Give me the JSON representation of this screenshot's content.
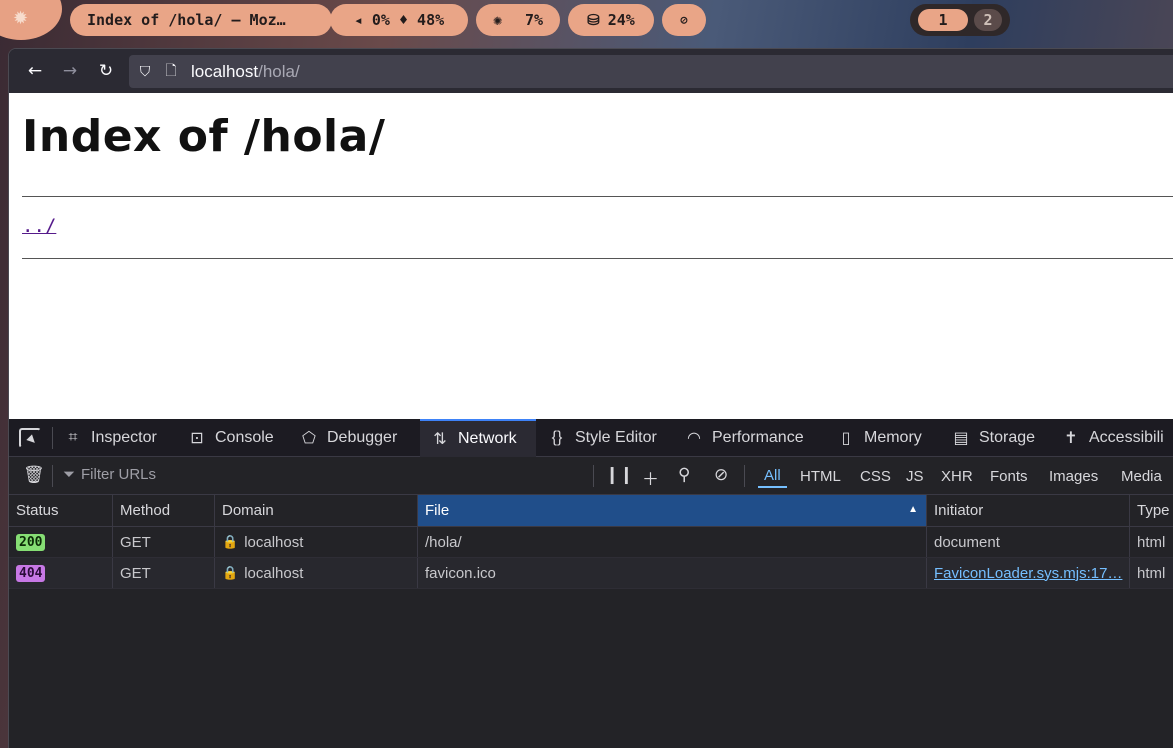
{
  "topbar": {
    "window_title": "Index of /hola/ — Moz…",
    "audio": "◂ 0% ♦ 48%",
    "cpu_value": "7%",
    "mem_value": "24%",
    "workspaces": [
      "1",
      "2"
    ],
    "colors": {
      "pill": "#e9a587",
      "pill_text": "#231c1c"
    }
  },
  "browser": {
    "url_host": "localhost",
    "url_path": "/hola/"
  },
  "page": {
    "heading": "Index of /hola/",
    "parent_link": "../"
  },
  "devtools": {
    "tabs": [
      "Inspector",
      "Console",
      "Debugger",
      "Network",
      "Style Editor",
      "Performance",
      "Memory",
      "Storage",
      "Accessibili"
    ],
    "selected_tab": "Network",
    "filter_placeholder": "Filter URLs",
    "filter_types": [
      "All",
      "HTML",
      "CSS",
      "JS",
      "XHR",
      "Fonts",
      "Images",
      "Media"
    ],
    "active_filter": "All",
    "columns": [
      "Status",
      "Method",
      "Domain",
      "File",
      "Initiator",
      "Type"
    ],
    "sorted_column": "File",
    "rows": [
      {
        "status": "200",
        "method": "GET",
        "domain": "localhost",
        "file": "/hola/",
        "initiator": "document",
        "type": "html"
      },
      {
        "status": "404",
        "method": "GET",
        "domain": "localhost",
        "file": "favicon.ico",
        "initiator": "FaviconLoader.sys.mjs:17…",
        "type": "html"
      }
    ],
    "colors": {
      "accent": "#3e82f7",
      "sorted_header": "#204e8a",
      "status_ok": "#86de74",
      "status_err": "#c778e5",
      "link": "#75bfff"
    }
  }
}
